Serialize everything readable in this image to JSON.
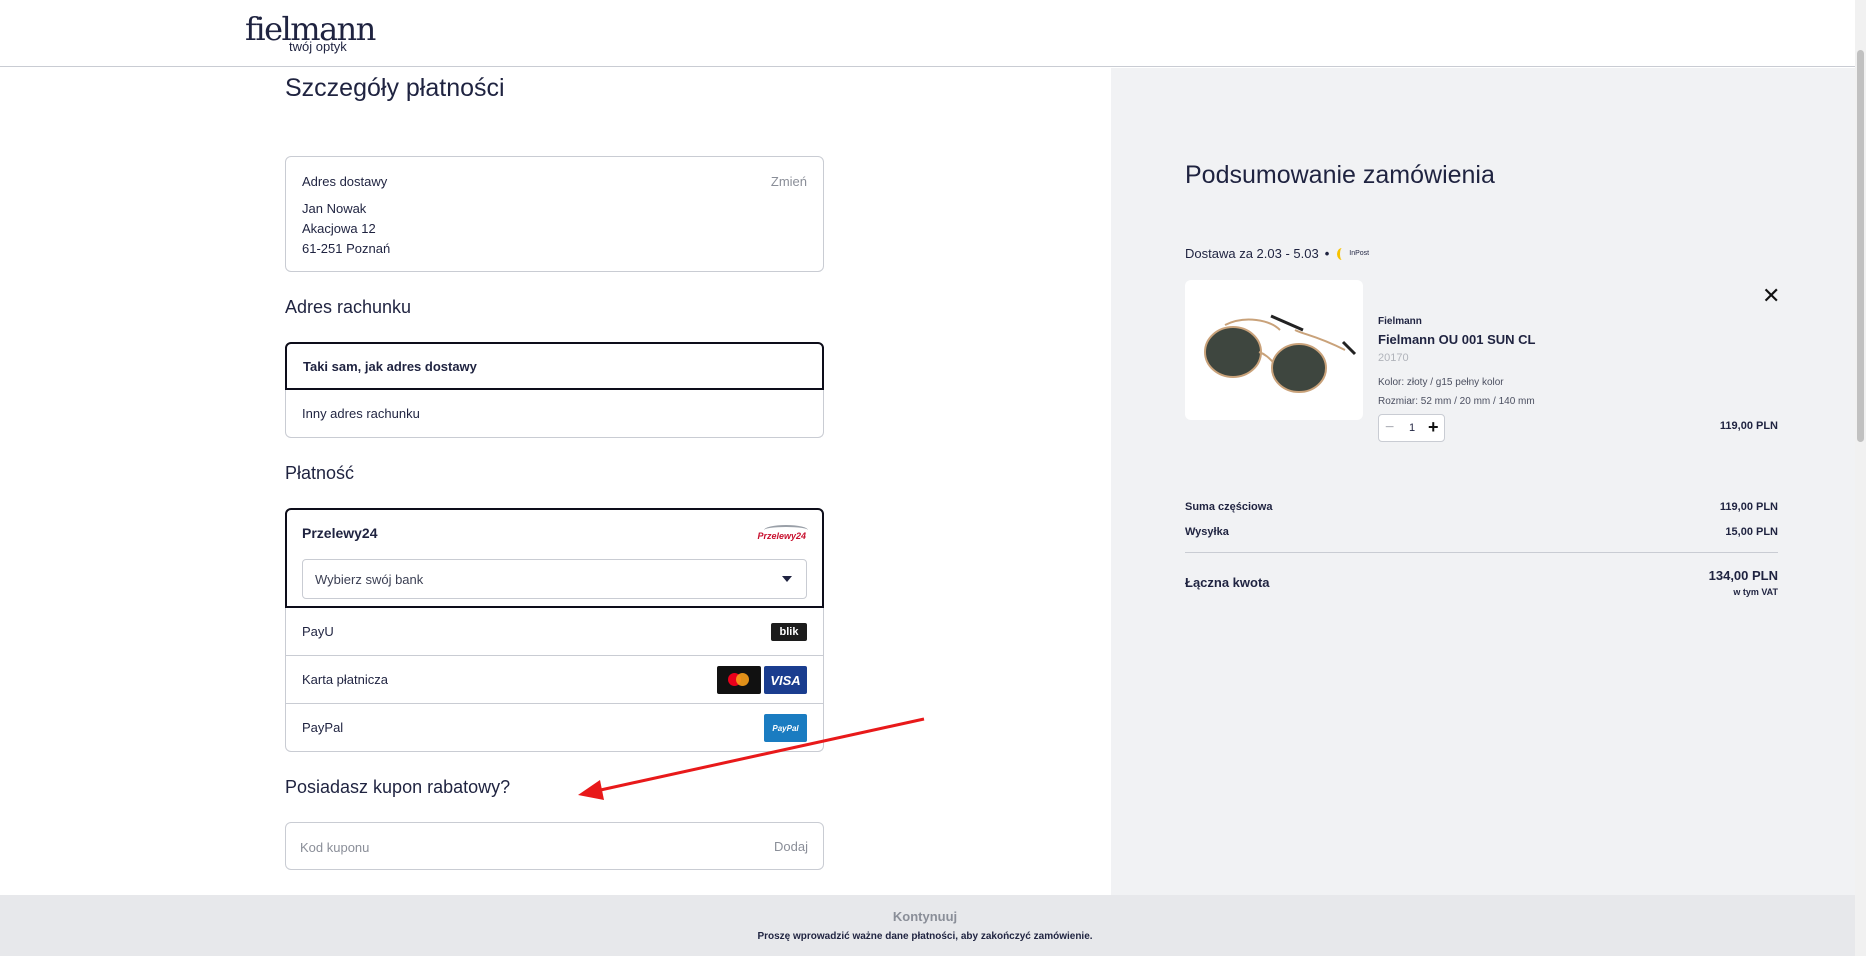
{
  "header": {
    "logo_main": "fielmann",
    "logo_sub": "twój optyk"
  },
  "page_title": "Szczegóły płatności",
  "shipping_address": {
    "label": "Adres dostawy",
    "change": "Zmień",
    "name": "Jan Nowak",
    "street": "Akacjowa 12",
    "city": "61-251 Poznań"
  },
  "billing": {
    "title": "Adres rachunku",
    "options": [
      "Taki sam, jak adres dostawy",
      "Inny adres rachunku"
    ]
  },
  "payment": {
    "title": "Płatność",
    "selected": "Przelewy24",
    "p24_logo_text": "Przelewy24",
    "bank_placeholder": "Wybierz swój bank",
    "methods": [
      "PayU",
      "Karta płatnicza",
      "PayPal"
    ],
    "blik_text": "blik",
    "visa_text": "VISA",
    "paypal_text": "PayPal"
  },
  "coupon": {
    "title": "Posiadasz kupon rabatowy?",
    "placeholder": "Kod kuponu",
    "add": "Dodaj"
  },
  "bottom_bar": {
    "continue": "Kontynuuj",
    "hint": "Proszę wprowadzić ważne dane płatności, aby zakończyć zamówienie."
  },
  "summary": {
    "title": "Podsumowanie zamówienia",
    "delivery": "Dostawa za 2.03 - 5.03",
    "bullet": "•",
    "carrier": "InPost",
    "product": {
      "brand": "Fielmann",
      "name": "Fielmann OU 001 SUN CL",
      "sku": "20170",
      "color": "Kolor: złoty / g15 pełny kolor",
      "size": "Rozmiar: 52 mm / 20 mm / 140 mm",
      "qty": "1",
      "price": "119,00 PLN"
    },
    "subtotal_label": "Suma częściowa",
    "subtotal": "119,00 PLN",
    "shipping_label": "Wysyłka",
    "shipping": "15,00 PLN",
    "total_label": "Łączna kwota",
    "total": "134,00 PLN",
    "vat_note": "w tym VAT"
  },
  "colors": {
    "accent": "#1f2340",
    "annotation": "#e8191a",
    "panel": "#f1f2f4"
  }
}
